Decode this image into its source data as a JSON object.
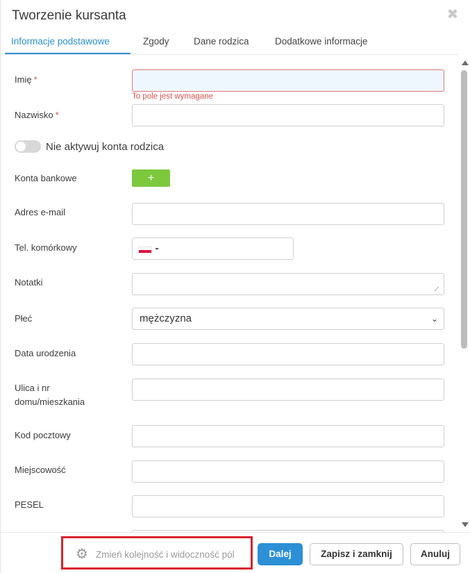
{
  "dialog": {
    "title": "Tworzenie kursanta"
  },
  "tabs": [
    {
      "label": "Informacje podstawowe",
      "active": true
    },
    {
      "label": "Zgody",
      "active": false
    },
    {
      "label": "Dane rodzica",
      "active": false
    },
    {
      "label": "Dodatkowe informacje",
      "active": false
    }
  ],
  "form": {
    "first_name": {
      "label": "Imię",
      "required_mark": "*",
      "value": "",
      "error": "To pole jest wymagane"
    },
    "last_name": {
      "label": "Nazwisko",
      "required_mark": "*",
      "value": ""
    },
    "parent_account_toggle": {
      "label": "Nie aktywuj konta rodzica",
      "checked": false
    },
    "bank_accounts": {
      "label": "Konta bankowe",
      "add_label": "+"
    },
    "email": {
      "label": "Adres e-mail",
      "value": ""
    },
    "mobile": {
      "label": "Tel. komórkowy",
      "country": "pl-flag-icon",
      "value": ""
    },
    "notes": {
      "label": "Notatki",
      "value": ""
    },
    "gender": {
      "label": "Płeć",
      "selected": "mężczyzna"
    },
    "birth_date": {
      "label": "Data urodzenia",
      "value": ""
    },
    "street": {
      "label": "Ulica i nr domu/mieszkania",
      "value": ""
    },
    "postal_code": {
      "label": "Kod pocztowy",
      "value": ""
    },
    "city": {
      "label": "Miejscowość",
      "value": ""
    },
    "pesel": {
      "label": "PESEL",
      "value": ""
    }
  },
  "footer": {
    "change_order_label": "Zmień kolejność i widoczność pól",
    "next_label": "Dalej",
    "save_close_label": "Zapisz i zamknij",
    "cancel_label": "Anuluj"
  },
  "colors": {
    "accent": "#2d8fd5",
    "error": "#d9534f",
    "add_button": "#7cc93e",
    "highlight": "#d9232d"
  }
}
